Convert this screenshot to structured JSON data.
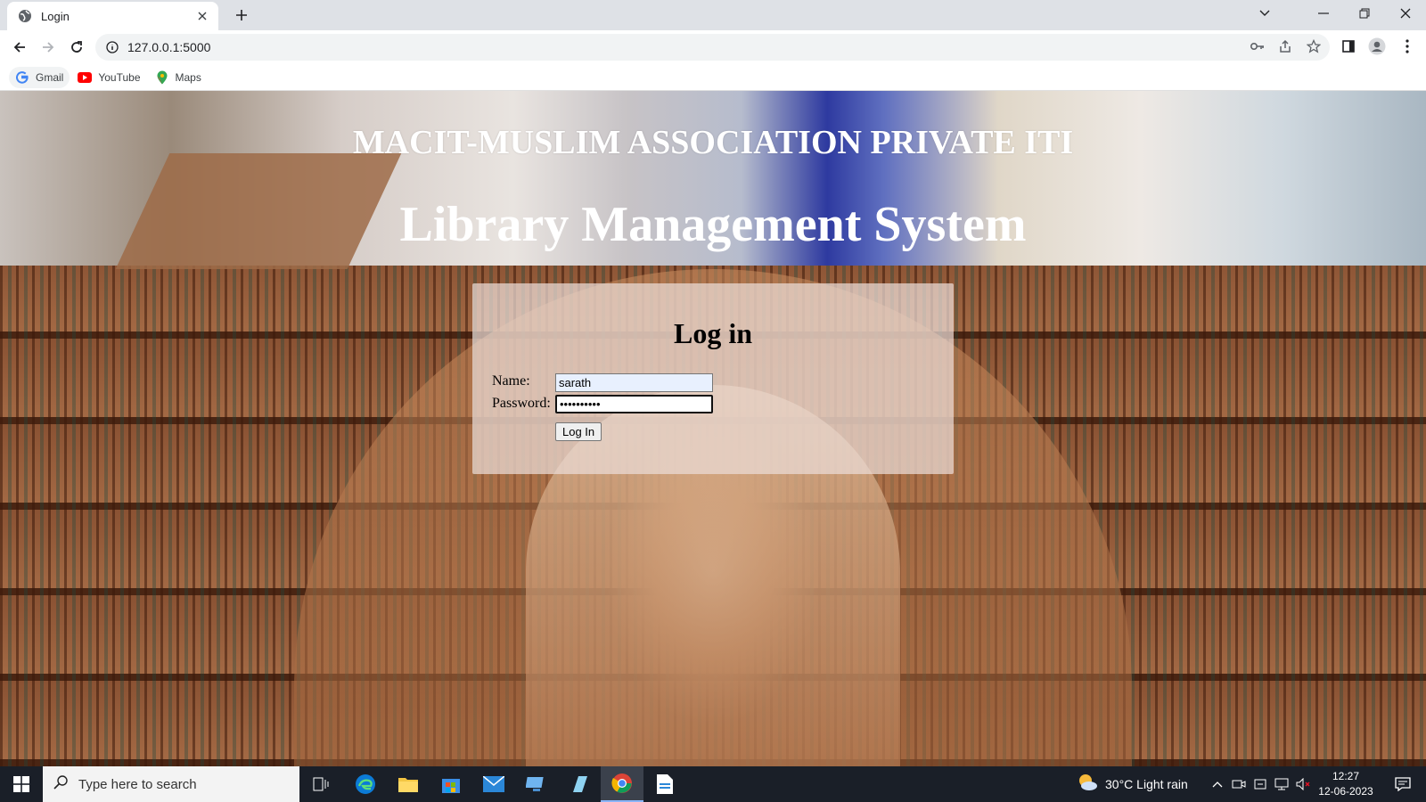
{
  "browser": {
    "tab_title": "Login",
    "url": "127.0.0.1:5000",
    "bookmarks": [
      {
        "label": "Gmail",
        "icon": "google-icon"
      },
      {
        "label": "YouTube",
        "icon": "youtube-icon"
      },
      {
        "label": "Maps",
        "icon": "maps-icon"
      }
    ]
  },
  "page": {
    "institution_title": "MACIT-MUSLIM ASSOCIATION PRIVATE ITI",
    "app_title": "Library Management System",
    "login": {
      "heading": "Log in",
      "name_label": "Name:",
      "name_value": "sarath",
      "password_label": "Password:",
      "password_value": "••••••••••",
      "submit_label": "Log In"
    }
  },
  "taskbar": {
    "search_placeholder": "Type here to search",
    "weather": "30°C  Light rain",
    "time": "12:27",
    "date": "12-06-2023"
  },
  "colors": {
    "taskbar_bg": "#1a1f28",
    "tabbar_bg": "#dee1e6",
    "title_text": "#ffffff"
  }
}
